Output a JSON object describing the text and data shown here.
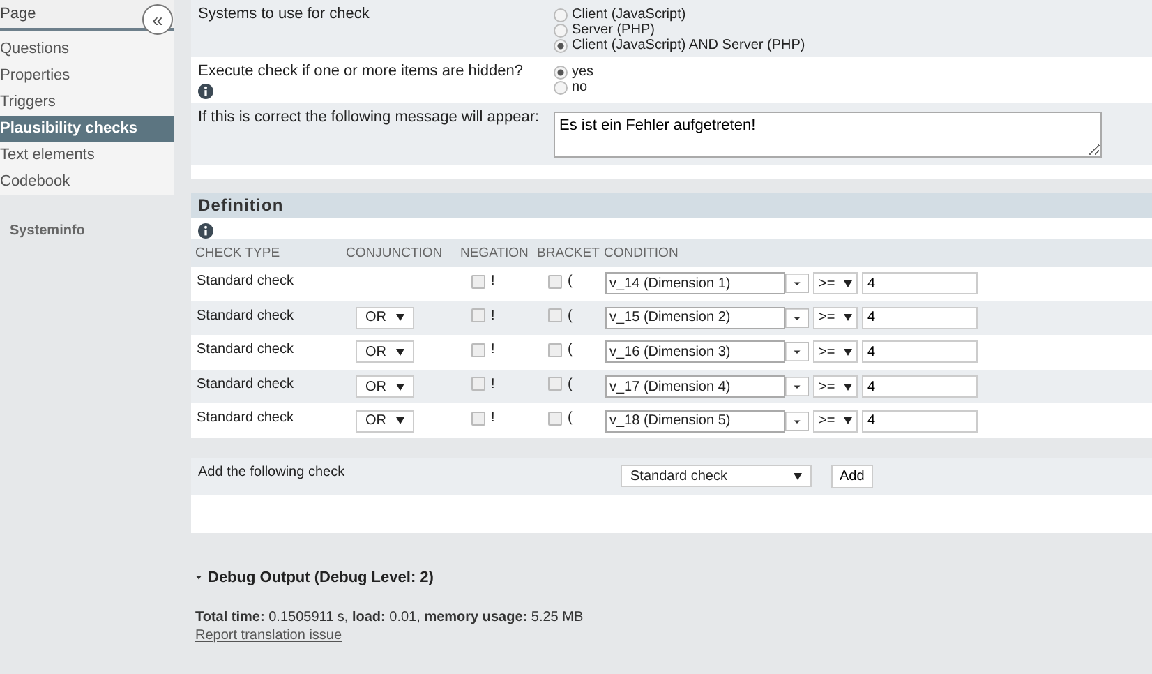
{
  "sidebar": {
    "title": "Page",
    "collapse_button": "«",
    "items": [
      {
        "label": "Questions",
        "selected": false
      },
      {
        "label": "Properties",
        "selected": false
      },
      {
        "label": "Triggers",
        "selected": false
      },
      {
        "label": "Plausibility checks",
        "selected": true
      },
      {
        "label": "Text elements",
        "selected": false
      },
      {
        "label": "Codebook",
        "selected": false
      }
    ],
    "footer": "Systeminfo"
  },
  "settings": [
    {
      "kind": "radio",
      "label": "Systems to use for check",
      "info": false,
      "options": [
        {
          "label": "Client (JavaScript)",
          "selected": false
        },
        {
          "label": "Server (PHP)",
          "selected": false
        },
        {
          "label": "Client (JavaScript) AND Server (PHP)",
          "selected": true
        }
      ]
    },
    {
      "kind": "radio",
      "label": "Execute check if one or more items are hidden?",
      "info": true,
      "options": [
        {
          "label": "yes",
          "selected": true
        },
        {
          "label": "no",
          "selected": false
        }
      ]
    },
    {
      "kind": "textarea",
      "label": "If this is correct the following message will appear:",
      "info": false,
      "value": "Es ist ein Fehler aufgetreten!"
    }
  ],
  "definition": {
    "title": "Definition",
    "columns": [
      "CHECK TYPE",
      "CONJUNCTION",
      "NEGATION",
      "BRACKET",
      "CONDITION"
    ],
    "rows": [
      {
        "check_type": "Standard check",
        "negation": {
          "checked": false,
          "symbol": "!"
        },
        "bracket": {
          "checked": false,
          "symbol": "("
        },
        "variable": "v_14 (Dimension 1)",
        "operator": ">=",
        "value": "4"
      },
      {
        "check_type": "Standard check",
        "conjunction": "OR",
        "negation": {
          "checked": false,
          "symbol": "!"
        },
        "bracket": {
          "checked": false,
          "symbol": "("
        },
        "variable": "v_15 (Dimension 2)",
        "operator": ">=",
        "value": "4"
      },
      {
        "check_type": "Standard check",
        "conjunction": "OR",
        "negation": {
          "checked": false,
          "symbol": "!"
        },
        "bracket": {
          "checked": false,
          "symbol": "("
        },
        "variable": "v_16 (Dimension 3)",
        "operator": ">=",
        "value": "4"
      },
      {
        "check_type": "Standard check",
        "conjunction": "OR",
        "negation": {
          "checked": false,
          "symbol": "!"
        },
        "bracket": {
          "checked": false,
          "symbol": "("
        },
        "variable": "v_17 (Dimension 4)",
        "operator": ">=",
        "value": "4"
      },
      {
        "check_type": "Standard check",
        "conjunction": "OR",
        "negation": {
          "checked": false,
          "symbol": "!"
        },
        "bracket": {
          "checked": false,
          "symbol": "("
        },
        "variable": "v_18 (Dimension 5)",
        "operator": ">=",
        "value": "4"
      }
    ],
    "add": {
      "label": "Add the following check",
      "select": "Standard check",
      "button": "Add"
    }
  },
  "debug": {
    "title": "Debug Output (Debug Level: 2)",
    "expanded": true,
    "stats": "**Total time:** 0.1505911 s, **load:** 0.01, **memory usage:** 5.25 MB",
    "link": "Report translation issue"
  }
}
